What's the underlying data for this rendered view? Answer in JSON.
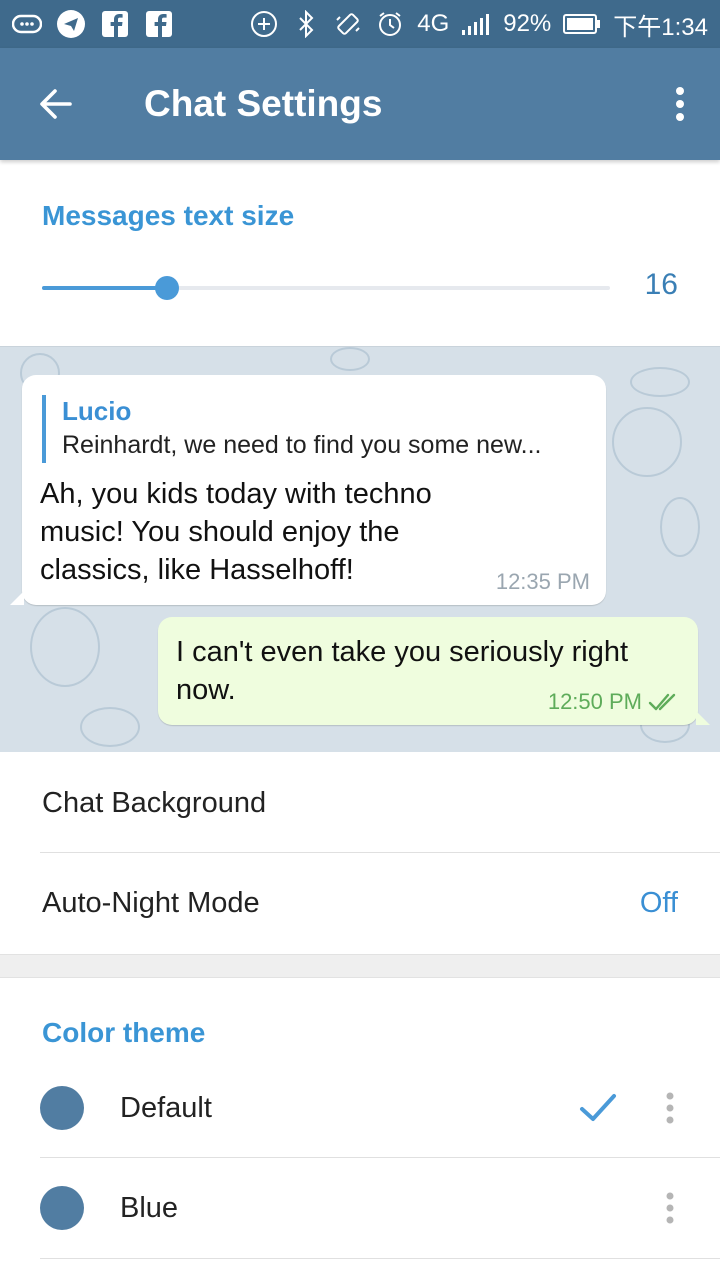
{
  "status_bar": {
    "network": "4G",
    "battery": "92%",
    "time": "下午1:34"
  },
  "app_bar": {
    "title": "Chat Settings"
  },
  "text_size": {
    "header": "Messages text size",
    "value": "16",
    "slider_fraction": 0.22
  },
  "preview": {
    "incoming": {
      "reply_name": "Lucio",
      "reply_text": "Reinhardt, we need to find you some new...",
      "text": "Ah, you kids today with techno music! You should enjoy the classics, like Hasselhoff!",
      "time": "12:35 PM"
    },
    "outgoing": {
      "text": "I can't even take you seriously right now.",
      "time": "12:50 PM"
    }
  },
  "settings": {
    "chat_background": "Chat Background",
    "auto_night_label": "Auto-Night Mode",
    "auto_night_value": "Off"
  },
  "color_theme": {
    "header": "Color theme",
    "themes": [
      {
        "label": "Default",
        "selected": true
      },
      {
        "label": "Blue",
        "selected": false
      }
    ]
  },
  "colors": {
    "app_bar": "#517da2",
    "status_bar": "#3f6a8c",
    "accent": "#3a95d5",
    "outgoing_bubble": "#effdde"
  }
}
